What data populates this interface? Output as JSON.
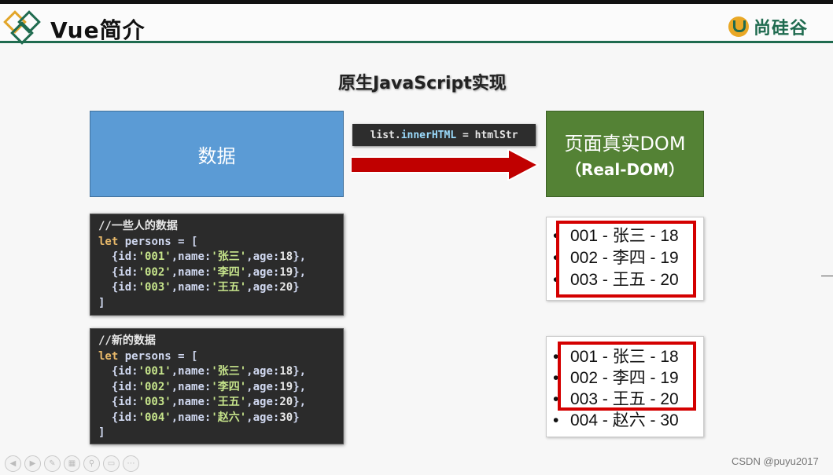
{
  "slide": {
    "title": "Vue简介",
    "brand": "尚硅谷",
    "section_title": "原生JavaScript实现"
  },
  "diagram": {
    "data_label": "数据",
    "code_pill": {
      "obj": "list",
      "prop": "innerHTML",
      "rest": " = htmlStr"
    },
    "dom_label_line1": "页面真实DOM",
    "dom_label_line2": "（Real-DOM）",
    "arrow_color": "#c00000"
  },
  "code_blocks": [
    {
      "comment": "//一些人的数据",
      "decl_kw": "let",
      "decl_rest": " persons = [",
      "rows": [
        {
          "id": "'001'",
          "name": "'张三'",
          "age": "18"
        },
        {
          "id": "'002'",
          "name": "'李四'",
          "age": "19"
        },
        {
          "id": "'003'",
          "name": "'王五'",
          "age": "20"
        }
      ],
      "close": "]"
    },
    {
      "comment": "//新的数据",
      "decl_kw": "let",
      "decl_rest": " persons = [",
      "rows": [
        {
          "id": "'001'",
          "name": "'张三'",
          "age": "18"
        },
        {
          "id": "'002'",
          "name": "'李四'",
          "age": "19"
        },
        {
          "id": "'003'",
          "name": "'王五'",
          "age": "20"
        },
        {
          "id": "'004'",
          "name": "'赵六'",
          "age": "30"
        }
      ],
      "close": "]"
    }
  ],
  "lists": [
    [
      "001 - 张三 - 18",
      "002 - 李四 - 19",
      "003 - 王五 - 20"
    ],
    [
      "001 - 张三 - 18",
      "002 - 李四 - 19",
      "003 - 王五 - 20",
      "004 - 赵六 - 30"
    ]
  ],
  "bullet": "•",
  "colors": {
    "accent_green": "#1f6b4f",
    "data_blue": "#5b9bd5",
    "dom_green": "#548235",
    "highlight_red": "#d40000"
  },
  "player_controls": [
    "prev-icon",
    "next-icon",
    "pen-icon",
    "grid-icon",
    "zoom-icon",
    "screen-icon",
    "more-icon"
  ],
  "watermark": "CSDN @puyu2017"
}
